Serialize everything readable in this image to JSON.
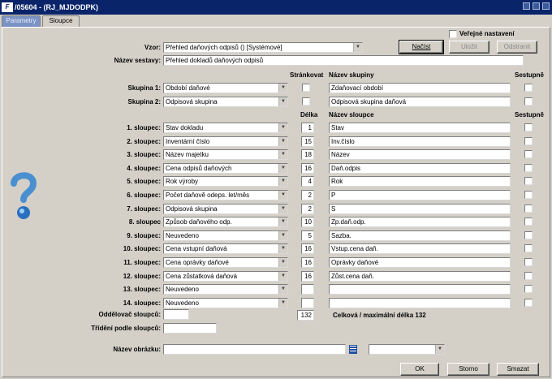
{
  "window": {
    "title": "/05604 - (RJ_MJDODPK)"
  },
  "tabs": [
    "Parametry",
    "Sloupce"
  ],
  "labels": {
    "vzor": "Vzor:",
    "nazev_sestavy": "Název sestavy:",
    "oddelovac": "Oddělovač sloupců:",
    "trideni": "Třídění podle sloupců:",
    "nazev_obrazku": "Název obrázku:",
    "celkova": "Celková / maximální délka 132"
  },
  "verejne": "Veřejné nastavení",
  "headers": {
    "strankovat": "Stránkovat",
    "nazev_skupiny": "Název skupiny",
    "sestupne": "Sestupně",
    "delka": "Délka",
    "nazev_sloupce": "Název sloupce"
  },
  "vzor_value": "Přehled daňových odpisů  ()  [Systémové]",
  "nazev_sestavy_value": "Přehled dokladů daňových odpisů",
  "groups": [
    {
      "label": "Skupina 1:",
      "value": "Období daňové",
      "name": "Zdaňovací období"
    },
    {
      "label": "Skupina 2:",
      "value": "Odpisová skupina",
      "name": "Odpisová skupina daňová"
    }
  ],
  "columns": [
    {
      "label": "1. sloupec:",
      "value": "Stav dokladu",
      "len": "1",
      "name": "Stav"
    },
    {
      "label": "2. sloupec:",
      "value": "Inventární číslo",
      "len": "15",
      "name": "Inv.číslo"
    },
    {
      "label": "3. sloupec:",
      "value": "Název majetku",
      "len": "18",
      "name": "Název"
    },
    {
      "label": "4. sloupec:",
      "value": "Cena odpisů daňových",
      "len": "16",
      "name": "Daň.odpis"
    },
    {
      "label": "5. sloupec:",
      "value": "Rok výroby",
      "len": "4",
      "name": "Rok"
    },
    {
      "label": "6. sloupec:",
      "value": "Počet daňově odeps. let/měs",
      "len": "2",
      "name": "P"
    },
    {
      "label": "7. sloupec:",
      "value": "Odpisová skupina",
      "len": "2",
      "name": "S"
    },
    {
      "label": "8. sloupec",
      "value": "Způsob daňového odp.",
      "len": "10",
      "name": "Zp.daň.odp."
    },
    {
      "label": "9. sloupec:",
      "value": "Neuvedeno",
      "len": "5",
      "name": "Sazba."
    },
    {
      "label": "10. sloupec:",
      "value": "Cena vstupní daňová",
      "len": "16",
      "name": "Vstup.cena daň."
    },
    {
      "label": "11. sloupec:",
      "value": "Cena oprávky daňové",
      "len": "16",
      "name": "Oprávky daňové"
    },
    {
      "label": "12. sloupec:",
      "value": "Cena zůstatková daňová",
      "len": "16",
      "name": "Zůst.cena daň."
    },
    {
      "label": "13. sloupec:",
      "value": "Neuvedeno",
      "len": "",
      "name": ""
    },
    {
      "label": "14. sloupec:",
      "value": "Neuvedeno",
      "len": "",
      "name": ""
    }
  ],
  "total_length": "132",
  "buttons": {
    "nacist": "Načíst",
    "ulozit": "Uložit",
    "odstranit": "Odstranit",
    "ok": "OK",
    "storno": "Storno",
    "smazat": "Smazat"
  },
  "colors": {
    "titlebar": "#0a246a",
    "face": "#d4d0c8",
    "help_icon": "#4a90d0"
  }
}
